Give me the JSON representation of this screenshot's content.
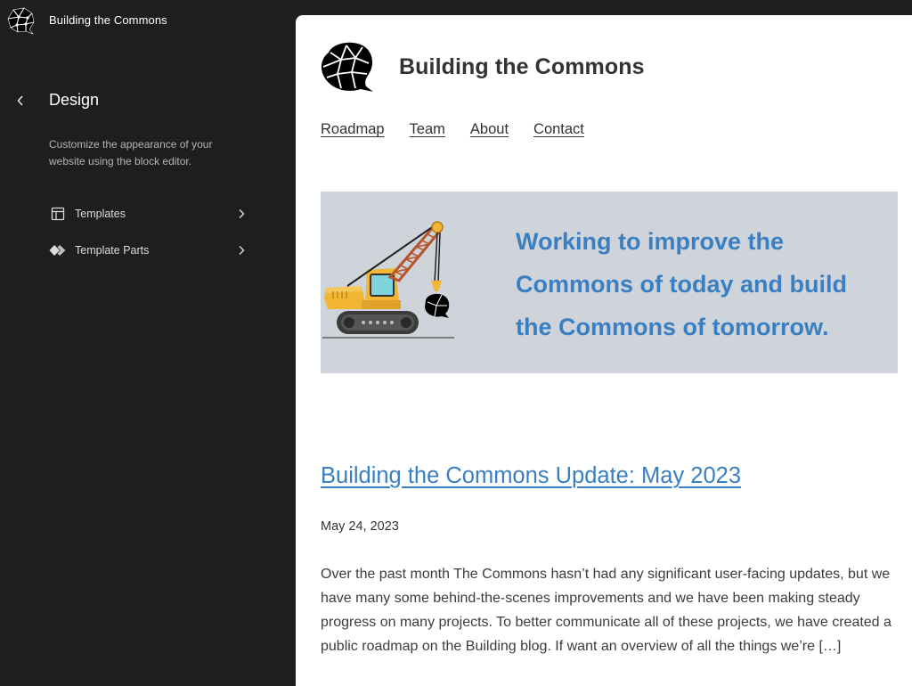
{
  "sidebar": {
    "site_title": "Building the Commons",
    "section_title": "Design",
    "description": "Customize the appearance of your website using the block editor.",
    "items": [
      {
        "label": "Templates",
        "icon": "layout-icon"
      },
      {
        "label": "Template Parts",
        "icon": "symbol-filled-icon"
      }
    ]
  },
  "preview": {
    "site_name": "Building the Commons",
    "nav": [
      "Roadmap",
      "Team",
      "About",
      "Contact"
    ],
    "hero": {
      "text": "Working to improve the Commons of today and build the Commons of tomorrow.",
      "background": "#cfd3da",
      "text_color": "#3a7fc1"
    },
    "post": {
      "title": "Building the Commons Update: May 2023",
      "date": "May 24, 2023",
      "excerpt": "Over the past month The Commons hasn’t had any significant user-facing updates, but we have many some behind-the-scenes improvements and we have been making steady progress on many projects. To better communicate all of these projects, we have created a public roadmap on the Building blog. If want an overview of all the things we’re […]"
    }
  },
  "colors": {
    "sidebar_bg": "#1e1e1e",
    "accent_link": "#3a7fc1"
  }
}
